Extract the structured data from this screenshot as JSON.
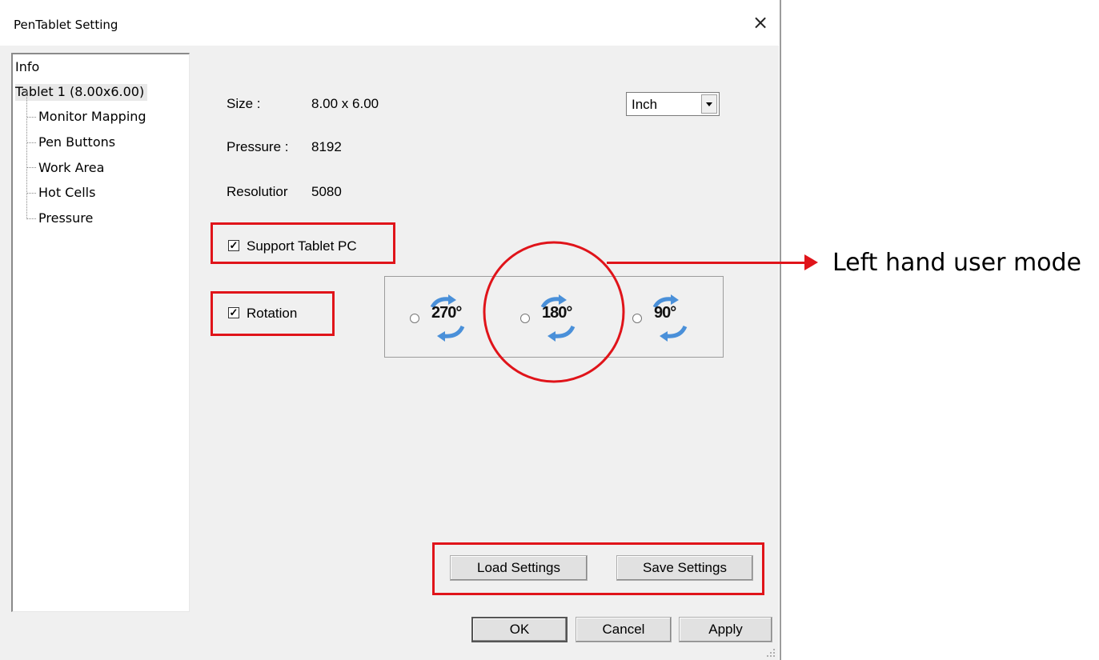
{
  "window": {
    "title": "PenTablet Setting",
    "close_glyph": "×"
  },
  "tree": {
    "items": [
      {
        "label": "Info"
      },
      {
        "label": "Tablet  1 (8.00x6.00)"
      }
    ],
    "children": [
      {
        "label": "Monitor Mapping"
      },
      {
        "label": "Pen Buttons"
      },
      {
        "label": "Work Area"
      },
      {
        "label": "Hot Cells"
      },
      {
        "label": "Pressure"
      }
    ]
  },
  "info": {
    "size_label": "Size :",
    "size_value": "8.00 x 6.00",
    "pressure_label": "Pressure :",
    "pressure_value": "8192",
    "resolution_label": "Resolutior",
    "resolution_value": "5080"
  },
  "unit_select": {
    "value": "Inch",
    "icon": "chevron-down-icon"
  },
  "support_tablet_pc": {
    "label": "Support Tablet PC",
    "checked": true,
    "check_glyph": "✓"
  },
  "rotation": {
    "label": "Rotation",
    "checked": true,
    "check_glyph": "✓",
    "options": [
      {
        "label": "270",
        "degree_glyph": "°",
        "selected": false,
        "icon": "rotate-icon"
      },
      {
        "label": "180",
        "degree_glyph": "°",
        "selected": false,
        "icon": "rotate-icon"
      },
      {
        "label": "90",
        "degree_glyph": "°",
        "selected": false,
        "icon": "rotate-icon"
      }
    ]
  },
  "buttons": {
    "load": "Load Settings",
    "save": "Save Settings",
    "ok": "OK",
    "cancel": "Cancel",
    "apply": "Apply"
  },
  "annotation": {
    "text": "Left hand user mode",
    "color": "#e0141a"
  }
}
